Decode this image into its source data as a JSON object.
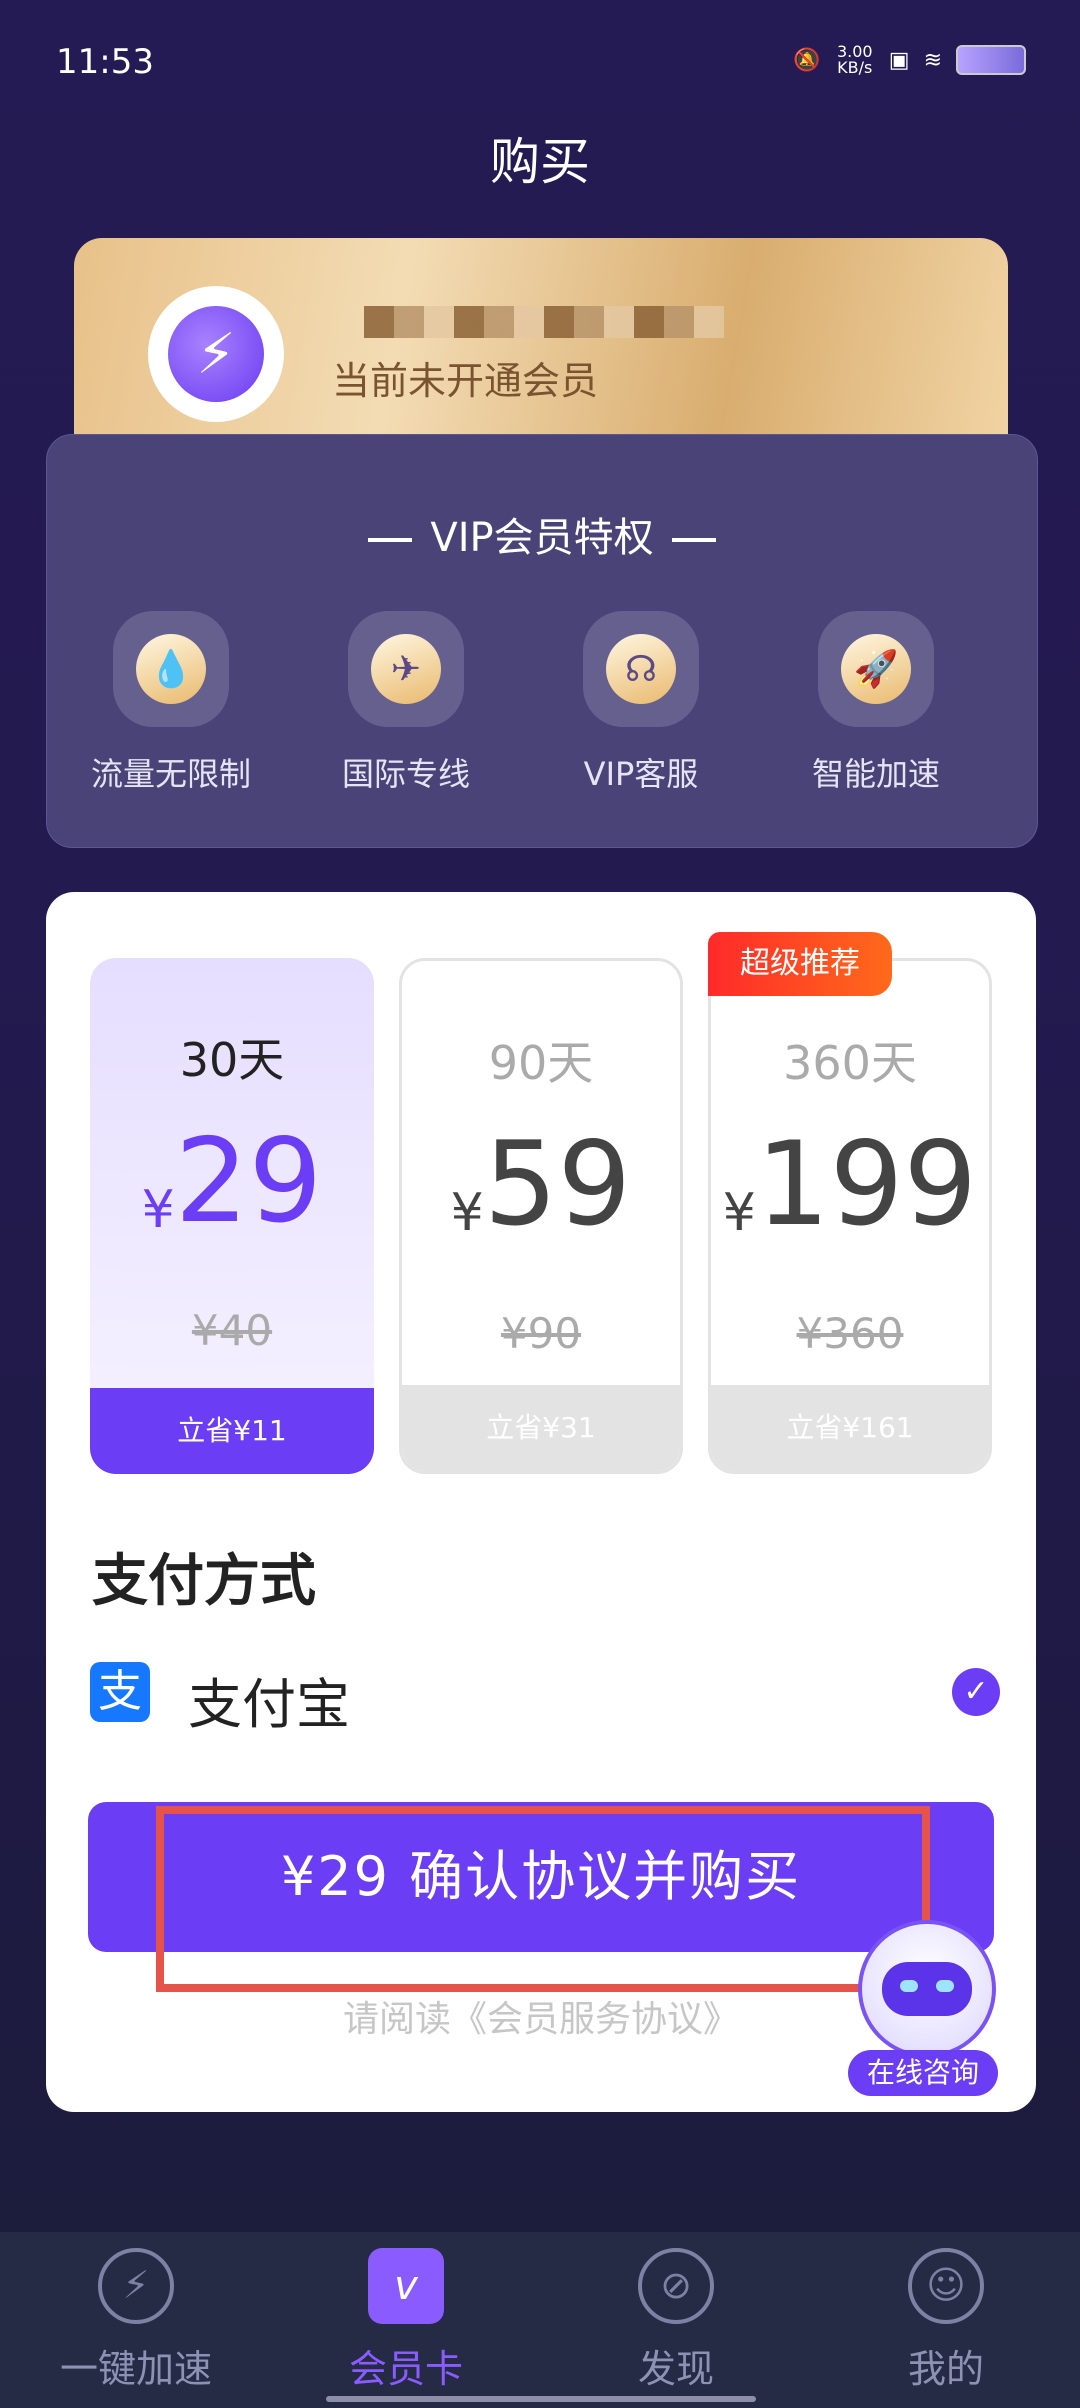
{
  "status_bar": {
    "time": "11:53",
    "net_speed": "3.00 KB/s"
  },
  "page": {
    "title": "购买"
  },
  "member": {
    "status": "当前未开通会员"
  },
  "vip": {
    "title": "VIP会员特权",
    "features": [
      {
        "label": "流量无限制",
        "icon": "drop-icon"
      },
      {
        "label": "国际专线",
        "icon": "globe-plane-icon"
      },
      {
        "label": "VIP客服",
        "icon": "headset-icon"
      },
      {
        "label": "智能加速",
        "icon": "rocket-icon"
      }
    ]
  },
  "plans": [
    {
      "duration": "30天",
      "currency": "¥",
      "price": "29",
      "original": "¥40",
      "save": "立省¥11",
      "selected": true
    },
    {
      "duration": "90天",
      "currency": "¥",
      "price": "59",
      "original": "¥90",
      "save": "立省¥31",
      "selected": false
    },
    {
      "duration": "360天",
      "currency": "¥",
      "price": "199",
      "original": "¥360",
      "save": "立省¥161",
      "selected": false,
      "badge": "超级推荐"
    }
  ],
  "payment": {
    "title": "支付方式",
    "method": "支付宝",
    "icon_char": "支"
  },
  "buy_button": {
    "label": "¥29  确认协议并购买"
  },
  "agreement": "请阅读《会员服务协议》",
  "assistant": {
    "label": "在线咨询"
  },
  "nav": [
    {
      "label": "一键加速",
      "icon": "lightning-icon"
    },
    {
      "label": "会员卡",
      "icon": "vip-card-icon",
      "active": true
    },
    {
      "label": "发现",
      "icon": "compass-icon"
    },
    {
      "label": "我的",
      "icon": "profile-icon"
    }
  ],
  "colors": {
    "accent": "#6b3df5",
    "badge": "#ff3a1f",
    "background": "#231a4f"
  }
}
